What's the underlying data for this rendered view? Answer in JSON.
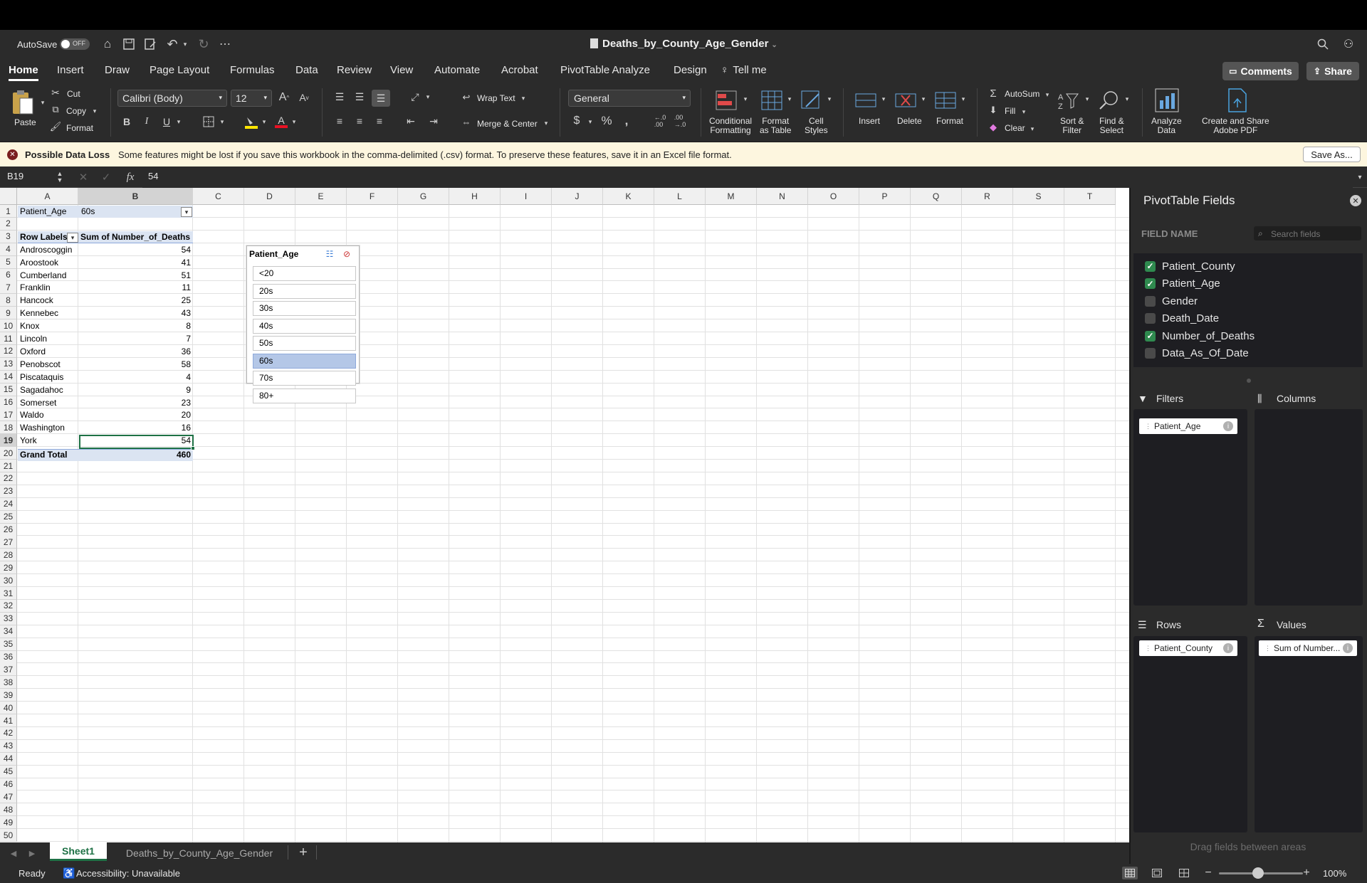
{
  "titlebar": {
    "autosave_label": "AutoSave",
    "autosave_state": "OFF",
    "filename": "Deaths_by_County_Age_Gender"
  },
  "tabs": [
    "Home",
    "Insert",
    "Draw",
    "Page Layout",
    "Formulas",
    "Data",
    "Review",
    "View",
    "Automate",
    "Acrobat",
    "PivotTable Analyze",
    "Design"
  ],
  "tell_me": "Tell me",
  "comments_label": "Comments",
  "share_label": "Share",
  "ribbon": {
    "paste": "Paste",
    "cut": "Cut",
    "copy": "Copy",
    "format_painter": "Format",
    "font_name": "Calibri (Body)",
    "font_size": "12",
    "bold": "B",
    "italic": "I",
    "underline": "U",
    "wrap_text": "Wrap Text",
    "merge_center": "Merge & Center",
    "number_format": "General",
    "conditional_formatting": "Conditional\nFormatting",
    "format_as_table": "Format\nas Table",
    "cell_styles": "Cell\nStyles",
    "insert": "Insert",
    "delete": "Delete",
    "format": "Format",
    "autosum": "AutoSum",
    "fill": "Fill",
    "clear": "Clear",
    "sort_filter": "Sort &\nFilter",
    "find_select": "Find &\nSelect",
    "analyze_data": "Analyze\nData",
    "create_share": "Create and Share\nAdobe PDF"
  },
  "message": {
    "title": "Possible Data Loss",
    "text": "Some features might be lost if you save this workbook in the comma-delimited (.csv) format. To preserve these features, save it in an Excel file format.",
    "button": "Save As..."
  },
  "formula": {
    "namebox": "B19",
    "fx": "fx",
    "value": "54"
  },
  "columns": [
    "A",
    "B",
    "C",
    "D",
    "E",
    "F",
    "G",
    "H",
    "I",
    "J",
    "K",
    "L",
    "M",
    "N",
    "O",
    "P",
    "Q",
    "R",
    "S",
    "T"
  ],
  "rows": [
    "1",
    "2",
    "3",
    "4",
    "5",
    "6",
    "7",
    "8",
    "9",
    "10",
    "11",
    "12",
    "13",
    "14",
    "15",
    "16",
    "17",
    "18",
    "19",
    "20",
    "21",
    "22",
    "23",
    "24",
    "25",
    "26",
    "27",
    "28",
    "29",
    "30",
    "31",
    "32",
    "33",
    "34",
    "35",
    "36",
    "37",
    "38",
    "39",
    "40",
    "41",
    "42",
    "43",
    "44",
    "45",
    "46",
    "47",
    "48",
    "49",
    "50"
  ],
  "pivot": {
    "filter_label": "Patient_Age",
    "filter_value": "60s",
    "row_labels_header": "Row Labels",
    "values_header": "Sum of Number_of_Deaths",
    "records": [
      {
        "county": "Androscoggin",
        "value": "54"
      },
      {
        "county": "Aroostook",
        "value": "41"
      },
      {
        "county": "Cumberland",
        "value": "51"
      },
      {
        "county": "Franklin",
        "value": "11"
      },
      {
        "county": "Hancock",
        "value": "25"
      },
      {
        "county": "Kennebec",
        "value": "43"
      },
      {
        "county": "Knox",
        "value": "8"
      },
      {
        "county": "Lincoln",
        "value": "7"
      },
      {
        "county": "Oxford",
        "value": "36"
      },
      {
        "county": "Penobscot",
        "value": "58"
      },
      {
        "county": "Piscataquis",
        "value": "4"
      },
      {
        "county": "Sagadahoc",
        "value": "9"
      },
      {
        "county": "Somerset",
        "value": "23"
      },
      {
        "county": "Waldo",
        "value": "20"
      },
      {
        "county": "Washington",
        "value": "16"
      },
      {
        "county": "York",
        "value": "54"
      }
    ],
    "grand_total_label": "Grand Total",
    "grand_total_value": "460"
  },
  "slicer": {
    "title": "Patient_Age",
    "items": [
      "<20",
      "20s",
      "30s",
      "40s",
      "50s",
      "60s",
      "70s",
      "80+"
    ],
    "selected": "60s"
  },
  "sheet_tabs": [
    "Sheet1",
    "Deaths_by_County_Age_Gender"
  ],
  "status": {
    "ready": "Ready",
    "accessibility": "Accessibility: Unavailable",
    "zoom": "100%"
  },
  "pivot_pane": {
    "title": "PivotTable Fields",
    "field_name_header": "FIELD NAME",
    "search_placeholder": "Search fields",
    "fields": [
      {
        "name": "Patient_County",
        "checked": true
      },
      {
        "name": "Patient_Age",
        "checked": true
      },
      {
        "name": "Gender",
        "checked": false
      },
      {
        "name": "Death_Date",
        "checked": false
      },
      {
        "name": "Number_of_Deaths",
        "checked": true
      },
      {
        "name": "Data_As_Of_Date",
        "checked": false
      }
    ],
    "filters_label": "Filters",
    "columns_label": "Columns",
    "rows_label": "Rows",
    "values_label": "Values",
    "filters_item": "Patient_Age",
    "rows_item": "Patient_County",
    "values_item": "Sum of Number...",
    "footer": "Drag fields between areas"
  }
}
